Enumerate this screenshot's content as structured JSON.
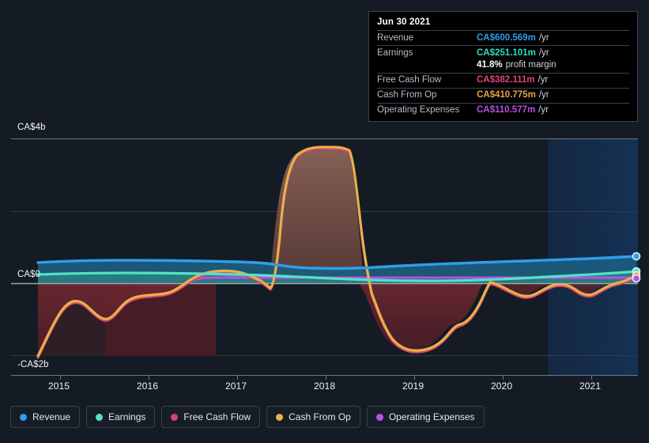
{
  "background": "#151b24",
  "tooltip": {
    "date": "Jun 30 2021",
    "rows": [
      {
        "key": "Revenue",
        "value": "CA$600.569m",
        "unit": "/yr",
        "color": "#2e9fe8"
      },
      {
        "key": "Earnings",
        "value": "CA$251.101m",
        "unit": "/yr",
        "color": "#2ee0bc"
      },
      {
        "key": "",
        "value": "41.8%",
        "unit": "profit margin",
        "color": "#ffffff"
      },
      {
        "key": "Free Cash Flow",
        "value": "CA$382.111m",
        "unit": "/yr",
        "color": "#e0457b"
      },
      {
        "key": "Cash From Op",
        "value": "CA$410.775m",
        "unit": "/yr",
        "color": "#e8a33d"
      },
      {
        "key": "Operating Expenses",
        "value": "CA$110.577m",
        "unit": "/yr",
        "color": "#b84fe8"
      }
    ]
  },
  "legend": {
    "items": [
      {
        "label": "Revenue",
        "color": "#2e9fe8"
      },
      {
        "label": "Earnings",
        "color": "#52e3c6"
      },
      {
        "label": "Free Cash Flow",
        "color": "#d9416f"
      },
      {
        "label": "Cash From Op",
        "color": "#e8b04a"
      },
      {
        "label": "Operating Expenses",
        "color": "#b84fe8"
      }
    ]
  },
  "chart_data": {
    "type": "area",
    "title": "",
    "xlabel": "",
    "ylabel": "",
    "grid": true,
    "legend_position": "bottom",
    "ylim": [
      -2,
      4
    ],
    "y_unit": "CA$b",
    "y_ticks": [
      {
        "value": 4,
        "label": "CA$4b"
      },
      {
        "value": 2,
        "label": ""
      },
      {
        "value": 0,
        "label": "CA$0"
      },
      {
        "value": -2,
        "label": "-CA$2b"
      }
    ],
    "x_ticks": [
      "2015",
      "2016",
      "2017",
      "2018",
      "2019",
      "2020",
      "2021"
    ],
    "xlim": [
      "2014-09",
      "2021-10"
    ],
    "forecast_start": "2020-06",
    "series": [
      {
        "name": "Revenue",
        "color": "#2e9fe8",
        "x": [
          2014.75,
          2015.0,
          2015.5,
          2016.0,
          2016.5,
          2017.0,
          2017.25,
          2017.5,
          2018.0,
          2018.5,
          2018.75,
          2019.0,
          2019.5,
          2020.0,
          2020.5,
          2021.0,
          2021.5
        ],
        "values": [
          0.34,
          0.35,
          0.36,
          0.36,
          0.36,
          0.37,
          0.36,
          0.34,
          0.33,
          0.33,
          0.3,
          0.3,
          0.32,
          0.35,
          0.43,
          0.52,
          0.6
        ]
      },
      {
        "name": "Earnings",
        "color": "#52e3c6",
        "x": [
          2014.75,
          2015.0,
          2015.5,
          2016.0,
          2016.5,
          2017.0,
          2017.5,
          2018.0,
          2018.5,
          2019.0,
          2019.5,
          2020.0,
          2020.5,
          2021.0,
          2021.5
        ],
        "values": [
          0.13,
          0.13,
          0.14,
          0.14,
          0.14,
          0.13,
          0.12,
          0.1,
          0.06,
          0.02,
          0.02,
          0.05,
          0.12,
          0.19,
          0.25
        ]
      },
      {
        "name": "Free Cash Flow",
        "color": "#d9416f",
        "x": [
          2014.75,
          2015.0,
          2015.3,
          2015.6,
          2016.0,
          2016.4,
          2016.8,
          2017.0,
          2017.3,
          2017.5,
          2017.7,
          2018.0,
          2018.4,
          2018.8,
          2019.0,
          2019.4,
          2019.7,
          2020.0,
          2020.4,
          2020.8,
          2021.1,
          2021.5
        ],
        "values": [
          -2.0,
          -1.38,
          -1.22,
          -1.43,
          -1.03,
          -0.83,
          -0.82,
          -0.4,
          0.05,
          0.1,
          -0.18,
          3.62,
          3.68,
          0.1,
          -0.9,
          -1.18,
          -0.73,
          0.03,
          -0.22,
          -0.3,
          -0.18,
          0.38
        ]
      },
      {
        "name": "Cash From Op",
        "color": "#e8b04a",
        "x": [
          2014.75,
          2015.0,
          2015.3,
          2015.6,
          2016.0,
          2016.4,
          2016.8,
          2017.0,
          2017.3,
          2017.5,
          2017.7,
          2017.9,
          2018.0,
          2018.45,
          2018.7,
          2018.9,
          2019.0,
          2019.4,
          2019.7,
          2020.0,
          2020.4,
          2020.8,
          2021.1,
          2021.5
        ],
        "values": [
          -2.0,
          -1.36,
          -1.2,
          -1.41,
          -1.0,
          -0.8,
          -0.79,
          -0.37,
          0.08,
          0.13,
          -0.15,
          1.8,
          3.64,
          3.7,
          1.6,
          -0.55,
          -0.92,
          -1.2,
          -0.75,
          0.06,
          -0.2,
          -0.27,
          -0.15,
          0.41
        ]
      },
      {
        "name": "Operating Expenses",
        "color": "#b84fe8",
        "x": [
          2016.9,
          2017.2,
          2017.6,
          2018.0,
          2018.5,
          2019.0,
          2019.5,
          2020.0,
          2020.5,
          2021.0,
          2021.5
        ],
        "values": [
          0.03,
          0.06,
          0.06,
          0.06,
          0.06,
          0.06,
          0.07,
          0.07,
          0.08,
          0.09,
          0.11
        ]
      }
    ]
  }
}
